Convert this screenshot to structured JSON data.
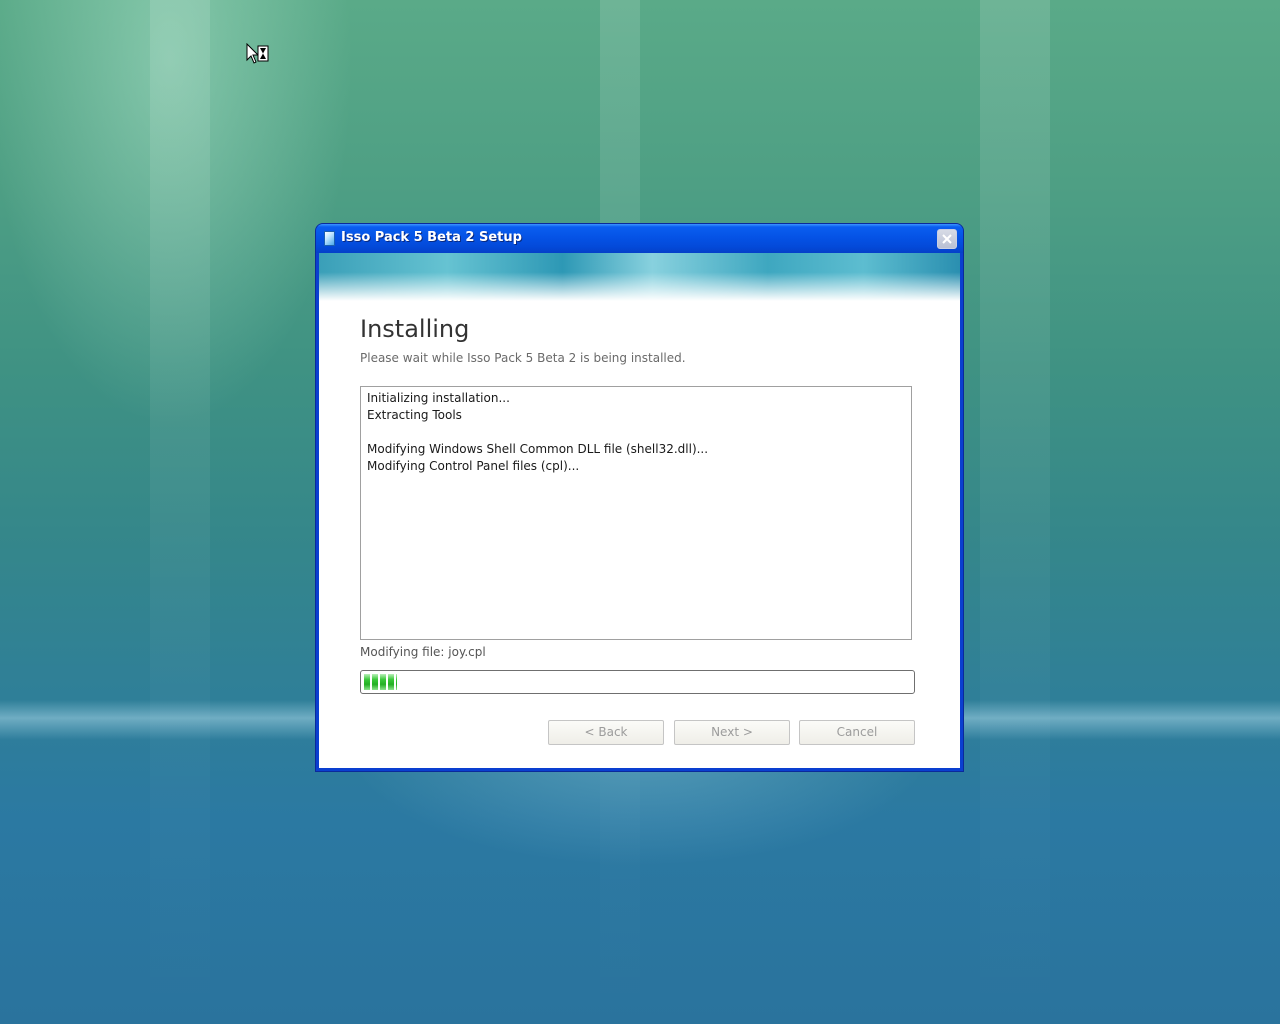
{
  "window": {
    "title": "Isso Pack 5 Beta 2 Setup"
  },
  "page": {
    "title": "Installing",
    "subtitle": "Please wait while Isso Pack 5 Beta 2 is being installed."
  },
  "log": {
    "lines": [
      "Initializing installation...",
      "Extracting Tools",
      "",
      "Modifying Windows Shell Common DLL file (shell32.dll)...",
      "Modifying Control Panel files (cpl)..."
    ]
  },
  "status": {
    "text": "Modifying file: joy.cpl",
    "progress_fraction": 0.06
  },
  "buttons": {
    "back": "< Back",
    "next": "Next >",
    "cancel": "Cancel"
  },
  "colors": {
    "titlebar": "#0553e6",
    "progress": "#2cb82c",
    "disabled_text": "#9c9c9c"
  }
}
